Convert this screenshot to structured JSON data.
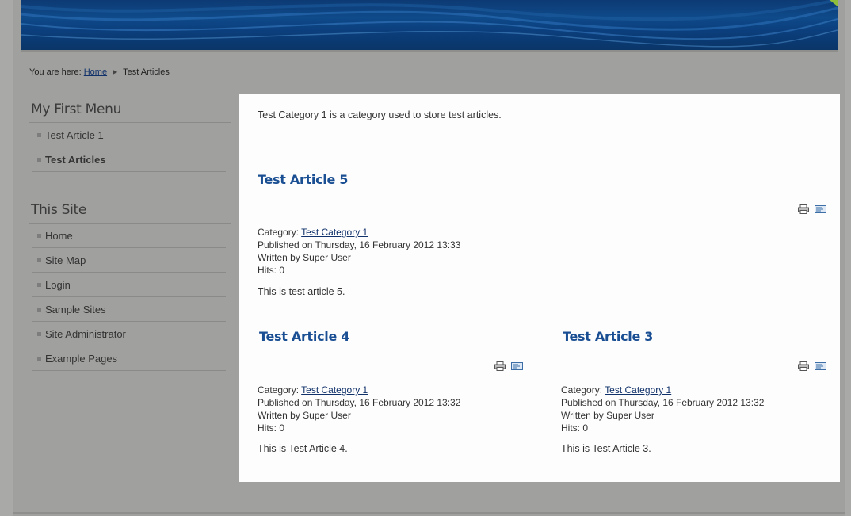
{
  "breadcrumb": {
    "prefix": "You are here:",
    "home": "Home",
    "current": "Test Articles"
  },
  "sidebar": {
    "menu1": {
      "title": "My First Menu",
      "items": [
        {
          "label": "Test Article 1"
        },
        {
          "label": "Test Articles"
        }
      ]
    },
    "menu2": {
      "title": "This Site",
      "items": [
        {
          "label": "Home"
        },
        {
          "label": "Site Map"
        },
        {
          "label": "Login"
        },
        {
          "label": "Sample Sites"
        },
        {
          "label": "Site Administrator"
        },
        {
          "label": "Example Pages"
        }
      ]
    }
  },
  "content": {
    "category_description": "Test Category 1 is a category used to store test articles.",
    "meta_labels": {
      "category": "Category:",
      "published_prefix": "Published on",
      "written_prefix": "Written by",
      "hits_prefix": "Hits:"
    },
    "articles": [
      {
        "title": "Test Article 5",
        "category": "Test Category 1",
        "published": "Thursday, 16 February 2012 13:33",
        "author": "Super User",
        "hits": "0",
        "intro": "This is test article 5."
      },
      {
        "title": "Test Article 4",
        "category": "Test Category 1",
        "published": "Thursday, 16 February 2012 13:32",
        "author": "Super User",
        "hits": "0",
        "intro": "This is Test Article 4."
      },
      {
        "title": "Test Article 3",
        "category": "Test Category 1",
        "published": "Thursday, 16 February 2012 13:32",
        "author": "Super User",
        "hits": "0",
        "intro": "This is Test Article 3."
      }
    ]
  },
  "icons": {
    "print": "print-icon",
    "email": "email-icon"
  },
  "colors": {
    "link": "#10316a",
    "title": "#1b4f93",
    "header": "#0f4a8a"
  }
}
